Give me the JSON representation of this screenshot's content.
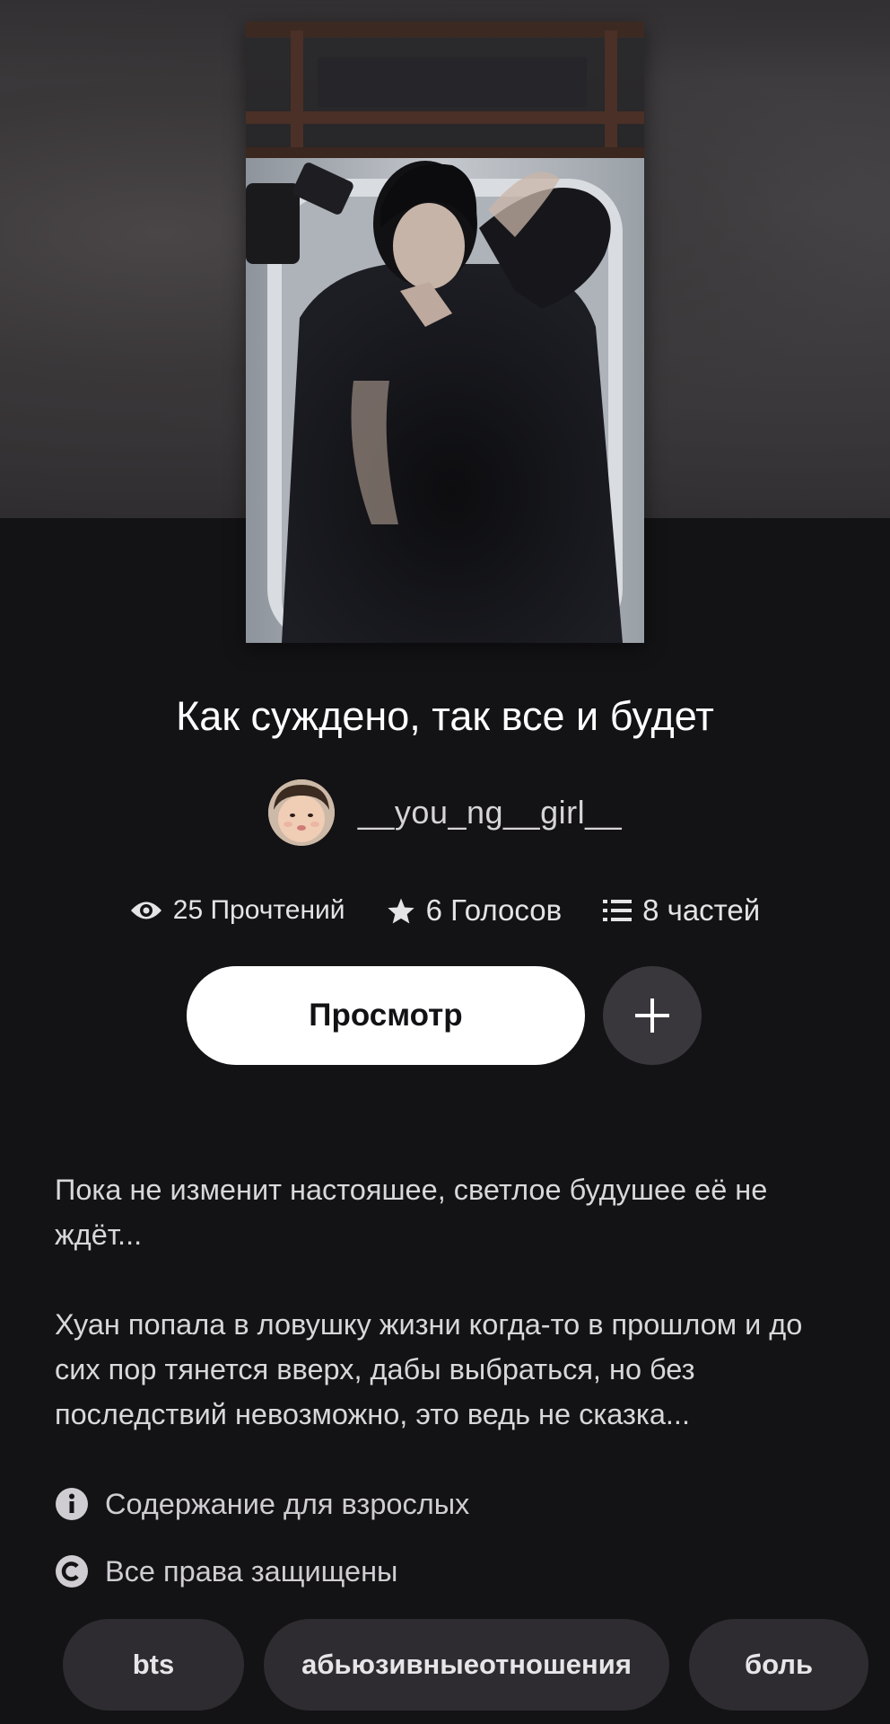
{
  "story": {
    "title": "Как суждено, так все и будет",
    "author": "__you_ng__girl__"
  },
  "stats": {
    "reads": "25 Прочтений",
    "votes": "6 Голосов",
    "parts": "8 частей"
  },
  "actions": {
    "read_label": "Просмотр"
  },
  "description": {
    "paragraph_1": "Пока не изменит настояшее, светлое будушее её не ждёт...",
    "paragraph_2": "Хуан попала в ловушку жизни когда-то в прошлом и до сих пор тянется вверх, дабы выбраться, но без последствий невозможно, это ведь не сказка..."
  },
  "meta": {
    "mature": "Содержание для взрослых",
    "copyright": "Все права защищены"
  },
  "tags": [
    "bts",
    "абьюзивныеотношения",
    "боль"
  ],
  "icons": {
    "reads": "eye-icon",
    "votes": "star-icon",
    "parts": "list-icon",
    "add": "plus-icon",
    "mature": "info-icon",
    "copyright": "copyright-icon"
  },
  "colors": {
    "background": "#131215",
    "primary_button": "#ffffff",
    "secondary_button": "#39373c",
    "tag_background": "#2e2c30"
  }
}
